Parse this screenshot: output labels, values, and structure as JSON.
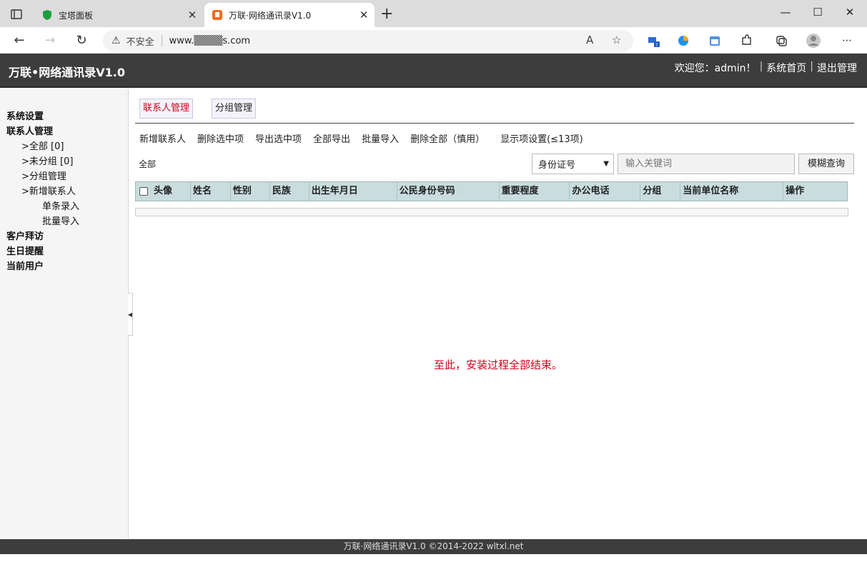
{
  "browser": {
    "tabs": [
      {
        "title": "宝塔面板",
        "close": "✕"
      },
      {
        "title": "万联·网络通讯录V1.0",
        "close": "✕"
      }
    ],
    "new_tab": "+",
    "window_controls": {
      "minimize": "—",
      "maximize": "☐",
      "close": "✕"
    },
    "address": {
      "security_label": "不安全",
      "url": "www.▒▒▒▒s.com"
    }
  },
  "app": {
    "title": "万联•网络通讯录V1.0",
    "welcome": "欢迎您：admin！",
    "home_link": "系统首页",
    "logout_link": "退出管理"
  },
  "sidebar": {
    "system_settings": "系统设置",
    "contacts_mgmt": "联系人管理",
    "all": ">全部 [0]",
    "ungrouped": ">未分组 [0]",
    "group_mgmt": ">分组管理",
    "add_contact": ">新增联系人",
    "single_entry": "单条录入",
    "batch_import": "批量导入",
    "customer_visits": "客户拜访",
    "birthday_reminder": "生日提醒",
    "current_user": "当前用户"
  },
  "main": {
    "subtabs": {
      "contacts": "联系人管理",
      "groups": "分组管理"
    },
    "actions": {
      "add": "新增联系人",
      "delete_selected": "删除选中项",
      "export_selected": "导出选中项",
      "export_all": "全部导出",
      "batch_import": "批量导入",
      "delete_all": "删除全部（慎用）",
      "display_settings": "显示项设置(≤13项)"
    },
    "filter_label": "全部",
    "search": {
      "field": "身份证号",
      "placeholder": "输入关键词",
      "button": "模糊查询"
    },
    "table": {
      "columns": [
        "头像",
        "姓名",
        "性别",
        "民族",
        "出生年月日",
        "公民身份号码",
        "重要程度",
        "办公电话",
        "分组",
        "当前单位名称",
        "操作"
      ]
    },
    "notice": "至此，安装过程全部结束。"
  },
  "footer": "万联·网络通讯录V1.0 ©2014-2022 wltxl.net",
  "colors": {
    "header_bg": "#3d3d3d",
    "table_header": "#c9dddd",
    "accent_red": "#d0021b"
  }
}
